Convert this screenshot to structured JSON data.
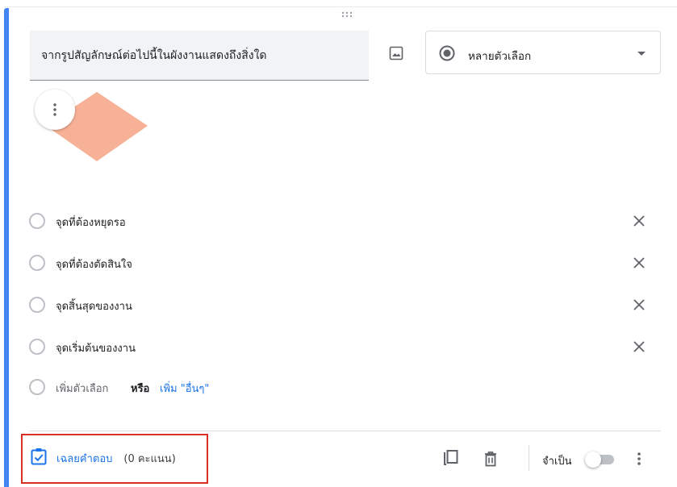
{
  "question": {
    "title": "จากรูปสัญลักษณ์ต่อไปนี้ในผังงานแสดงถึงสิ่งใด",
    "type": "หลายตัวเลือก"
  },
  "image": {
    "shape": "diamond",
    "color": "#f7b196"
  },
  "options": [
    {
      "label": "จุดที่ต้องหยุดรอ"
    },
    {
      "label": "จุดที่ต้องตัดสินใจ"
    },
    {
      "label": "จุดสิ้นสุดของงาน"
    },
    {
      "label": "จุดเริ่มต้นของงาน"
    }
  ],
  "add_option": {
    "label": "เพิ่มตัวเลือก",
    "or": "หรือ",
    "add_other": "เพิ่ม \"อื่นๆ\""
  },
  "footer": {
    "answer_key_label": "เฉลยคำตอบ",
    "points": "(0 คะแนน)",
    "required_label": "จำเป็น",
    "required_on": false
  },
  "colors": {
    "accent": "#4285f4",
    "link": "#1a73e8",
    "highlight_box": "#d93025"
  }
}
